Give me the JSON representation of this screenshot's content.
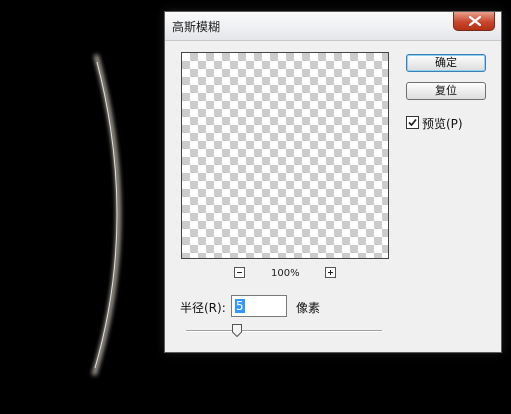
{
  "dialog": {
    "title": "高斯模糊"
  },
  "buttons": {
    "ok": "确定",
    "reset": "复位"
  },
  "preview_option": {
    "label": "预览(P)",
    "checked": true
  },
  "zoom": {
    "level": "100%",
    "zoom_out_icon": "minus-icon",
    "zoom_in_icon": "plus-icon"
  },
  "radius": {
    "label": "半径(R):",
    "value": "5",
    "unit": "像素",
    "slider_level_fraction": 0.26
  },
  "colors": {
    "title_close": "#c9462c",
    "selection": "#3399ff",
    "dialog_bg": "#f0f0f0"
  }
}
